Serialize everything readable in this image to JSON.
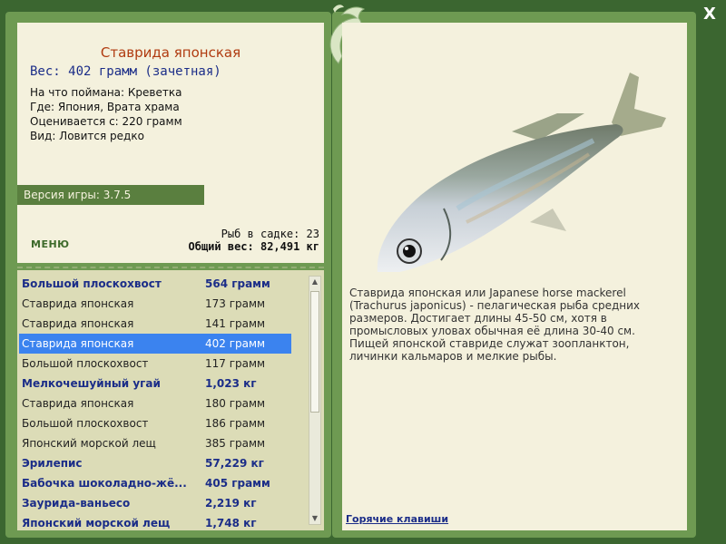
{
  "fish": {
    "title": "Ставрида японская",
    "weight_line": "Вес: 402 грамм (зачетная)",
    "details": [
      "На что поймана: Креветка",
      "Где: Япония, Врата храма",
      "Оценивается с: 220 грамм",
      "Вид: Ловится редко"
    ],
    "description": "Ставрида японская или Japanese horse mackerel (Trachurus japonicus) - пелагическая рыба средних размеров. Достигает длины 45-50 см, хотя в промысловых уловах обычная её длина 30-40 см. Пищей японской ставриде служат зоопланктон, личинки кальмаров и мелкие рыбы."
  },
  "version": "Версия игры: 3.7.5",
  "menu_label": "МЕНЮ",
  "stats": {
    "fish_count": "Рыб в садке: 23",
    "total_weight": "Общий вес: 82,491 кг"
  },
  "catch_list": [
    {
      "name": "Большой плоскохвост",
      "weight": "564 грамм",
      "bold": true
    },
    {
      "name": "Ставрида японская",
      "weight": "173 грамм",
      "bold": false
    },
    {
      "name": "Ставрида японская",
      "weight": "141 грамм",
      "bold": false
    },
    {
      "name": "Ставрида японская",
      "weight": "402 грамм",
      "bold": false,
      "selected": true
    },
    {
      "name": "Большой плоскохвост",
      "weight": "117 грамм",
      "bold": false
    },
    {
      "name": "Мелкочешуйный угай",
      "weight": "1,023 кг",
      "bold": true
    },
    {
      "name": "Ставрида японская",
      "weight": "180 грамм",
      "bold": false
    },
    {
      "name": "Большой плоскохвост",
      "weight": "186 грамм",
      "bold": false
    },
    {
      "name": "Японский морской лещ",
      "weight": "385 грамм",
      "bold": false
    },
    {
      "name": "Эрилепис",
      "weight": "57,229 кг",
      "bold": true
    },
    {
      "name": "Бабочка шоколадно-жё...",
      "weight": "405 грамм",
      "bold": true
    },
    {
      "name": "Заурида-ваньесо",
      "weight": "2,219 кг",
      "bold": true
    },
    {
      "name": "Японский морской лещ",
      "weight": "1,748 кг",
      "bold": true
    }
  ],
  "hotkeys_label": "Горячие клавиши",
  "close_label": "X",
  "icons": {
    "close": "close-icon",
    "logo": "dolphin-logo-icon",
    "scroll_up": "arrow-up-icon",
    "scroll_down": "arrow-down-icon"
  },
  "colors": {
    "frame": "#6e9a52",
    "background": "#3b6630",
    "title": "#b03b10",
    "accent_blue": "#1b2d88",
    "selection": "#3b83ef"
  }
}
